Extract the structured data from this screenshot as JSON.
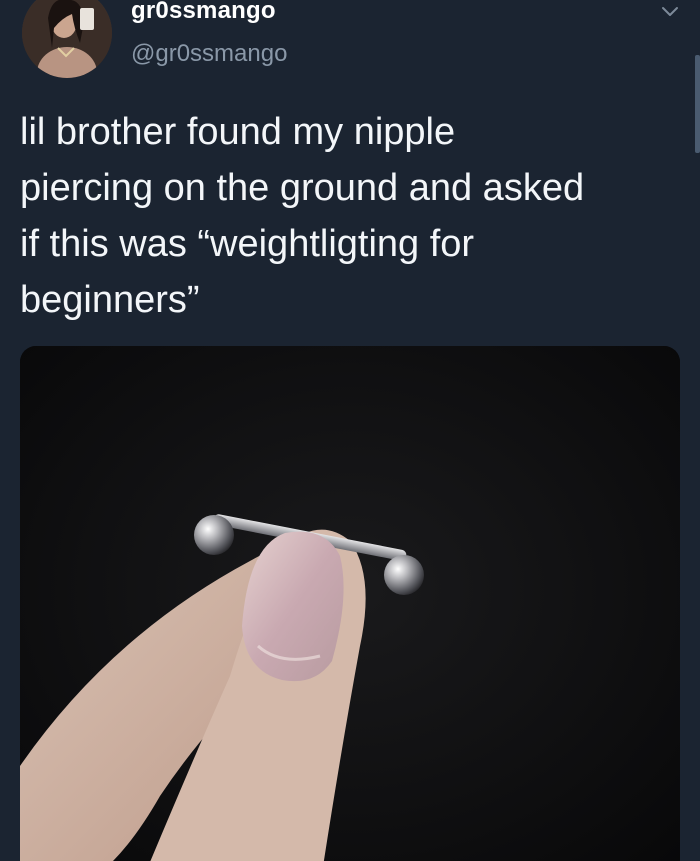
{
  "user": {
    "display_name": "gr0ssmango",
    "handle": "@gr0ssmango",
    "avatar_icon": "profile-photo"
  },
  "tweet": {
    "text": "lil brother found my nipple\npiercing on the ground and asked\nif this was “weightligting for\nbeginners”"
  },
  "media": {
    "icon": "barbell-piercing-held-between-fingers-photo"
  },
  "menu": {
    "icon": "chevron-down-icon"
  },
  "colors": {
    "background": "#1b2431",
    "text": "#f3f6f9",
    "secondary_text": "#8a98a8"
  }
}
